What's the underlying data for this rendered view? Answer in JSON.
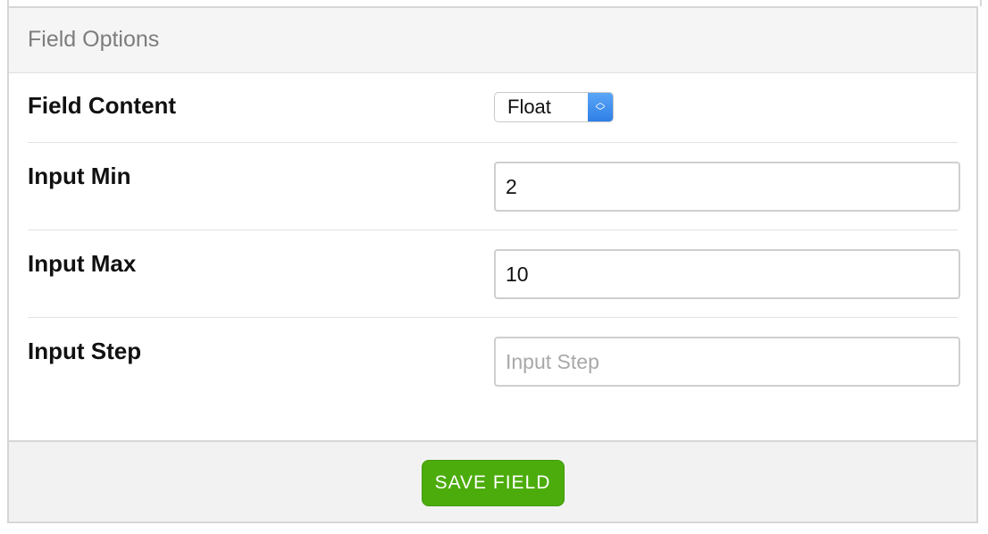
{
  "panel": {
    "title": "Field Options"
  },
  "fields": {
    "field_content": {
      "label": "Field Content",
      "selected": "Float"
    },
    "input_min": {
      "label": "Input Min",
      "value": "2"
    },
    "input_max": {
      "label": "Input Max",
      "value": "10"
    },
    "input_step": {
      "label": "Input Step",
      "value": "",
      "placeholder": "Input Step"
    }
  },
  "footer": {
    "save_label": "SAVE FIELD"
  },
  "colors": {
    "save_button": "#4cac0c",
    "select_arrow": "#3b8ff0",
    "header_bg": "#f5f5f5"
  }
}
